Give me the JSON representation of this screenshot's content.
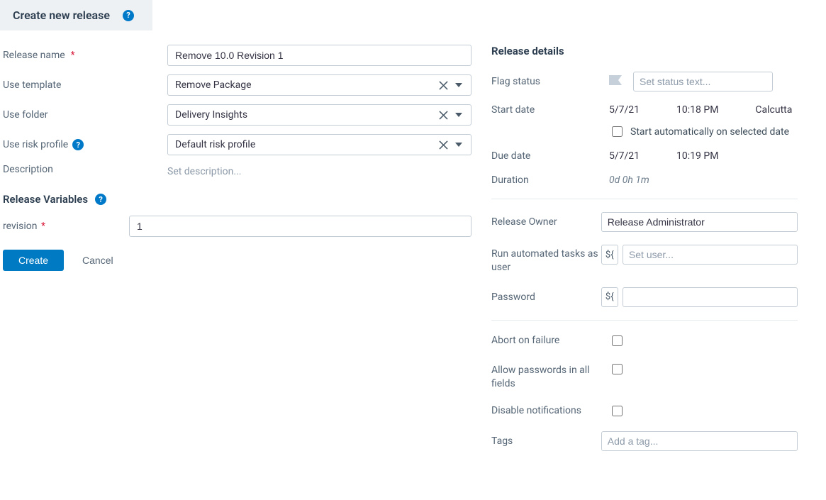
{
  "header": {
    "title": "Create new release"
  },
  "left": {
    "releaseName": {
      "label": "Release name",
      "value": "Remove 10.0 Revision 1"
    },
    "useTemplate": {
      "label": "Use template",
      "value": "Remove Package"
    },
    "useFolder": {
      "label": "Use folder",
      "value": "Delivery Insights"
    },
    "riskProfile": {
      "label": "Use risk profile",
      "value": "Default risk profile"
    },
    "description": {
      "label": "Description",
      "placeholder": "Set description..."
    },
    "varsTitle": "Release Variables",
    "revision": {
      "label": "revision",
      "value": "1"
    },
    "createBtn": "Create",
    "cancelBtn": "Cancel"
  },
  "right": {
    "title": "Release details",
    "flagStatus": {
      "label": "Flag status",
      "placeholder": "Set status text..."
    },
    "startDate": {
      "label": "Start date",
      "date": "5/7/21",
      "time": "10:18 PM",
      "tz": "Calcutta"
    },
    "autoStart": {
      "label": "Start automatically on selected date",
      "checked": false
    },
    "dueDate": {
      "label": "Due date",
      "date": "5/7/21",
      "time": "10:19 PM"
    },
    "duration": {
      "label": "Duration",
      "value": "0d 0h 1m"
    },
    "owner": {
      "label": "Release Owner",
      "value": "Release Administrator"
    },
    "runAs": {
      "label": "Run automated tasks as user",
      "placeholder": "Set user..."
    },
    "password": {
      "label": "Password"
    },
    "abort": {
      "label": "Abort on failure",
      "checked": false
    },
    "allowPw": {
      "label": "Allow passwords in all fields",
      "checked": false
    },
    "disableN": {
      "label": "Disable notifications",
      "checked": false
    },
    "tags": {
      "label": "Tags",
      "placeholder": "Add a tag..."
    },
    "varIcon": "${"
  }
}
